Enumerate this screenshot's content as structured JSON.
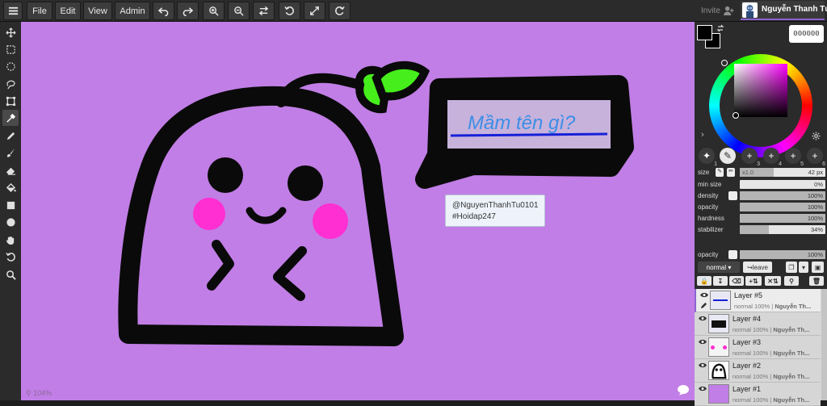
{
  "toolbar": {
    "menu_icon": "hamburger-icon",
    "file": "File",
    "edit": "Edit",
    "view": "View",
    "admin": "Admin",
    "invite": "Invite",
    "username": "Nguyễn Thanh Tú"
  },
  "canvas": {
    "zoom": "104%",
    "bubble_text": "Mầm tên gì?",
    "background_color": "#c17ee6"
  },
  "tooltip": {
    "line1": "@NguyenThanhTu0101",
    "line2": "#Hoidap247"
  },
  "color": {
    "hex": "000000",
    "primary": "#000000",
    "secondary": "#ffffff"
  },
  "brush_slots": [
    "1",
    "2",
    "3",
    "4",
    "5",
    "6"
  ],
  "brush_props": {
    "size_label": "size",
    "size_mult": "x1.0",
    "size_value": "42 px",
    "min_size_label": "min size",
    "min_size_value": "0%",
    "density_label": "density",
    "density_value": "100%",
    "opacity_label": "opacity",
    "opacity_value": "100%",
    "hardness_label": "hardness",
    "hardness_value": "100%",
    "stabilizer_label": "stabilizer",
    "stabilizer_value": "34%",
    "stabilizer_fraction": 0.34
  },
  "layer_opacity": {
    "label": "opacity",
    "value": "100%"
  },
  "layer_controls": {
    "blend_mode": "normal",
    "leave": "leave"
  },
  "layers": [
    {
      "name": "Layer #5",
      "mode": "normal",
      "opacity": "100%",
      "owner": "Nguyễn Th..."
    },
    {
      "name": "Layer #4",
      "mode": "normal",
      "opacity": "100%",
      "owner": "Nguyễn Th..."
    },
    {
      "name": "Layer #3",
      "mode": "normal",
      "opacity": "100%",
      "owner": "Nguyễn Th..."
    },
    {
      "name": "Layer #2",
      "mode": "normal",
      "opacity": "100%",
      "owner": "Nguyễn Th..."
    },
    {
      "name": "Layer #1",
      "mode": "normal",
      "opacity": "100%",
      "owner": "Nguyễn Th..."
    }
  ]
}
